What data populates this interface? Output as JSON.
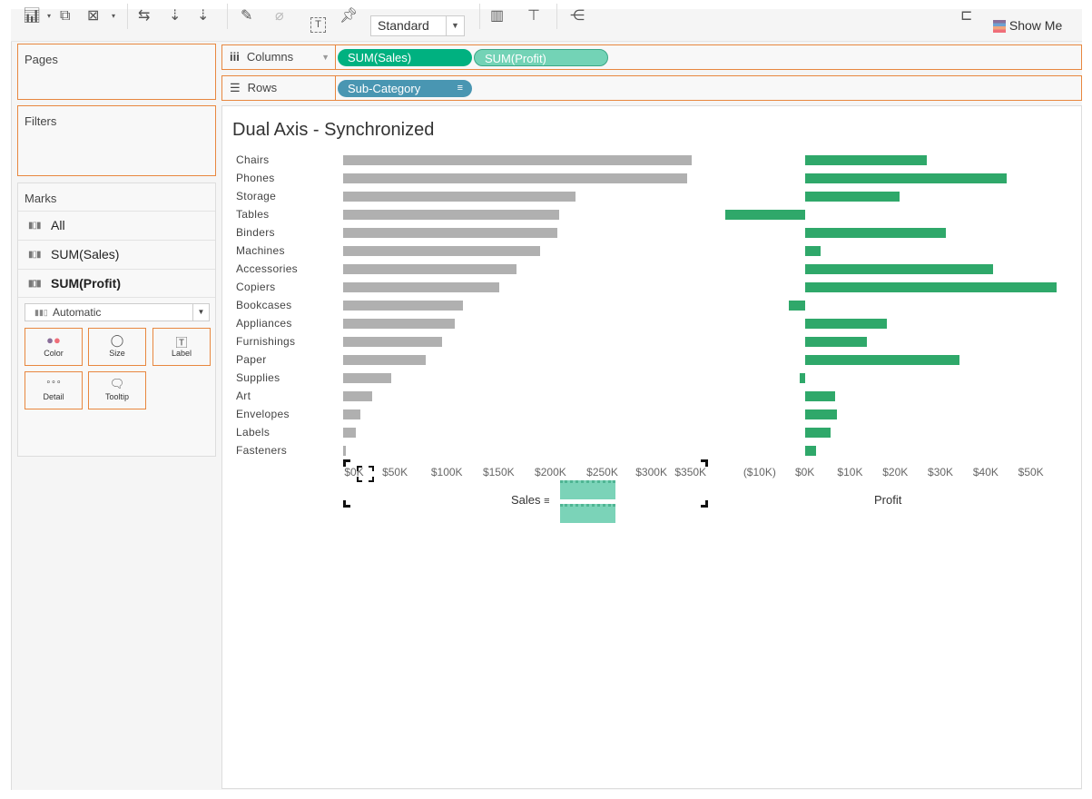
{
  "toolbar": {
    "mark_type_select": "Standard",
    "show_me_label": "Show Me",
    "icons": [
      "new-worksheet-icon",
      "duplicate-sheet-icon",
      "clear-sheet-icon",
      "swap-icon",
      "sort-ascending-icon",
      "sort-descending-icon",
      "highlight-icon",
      "group-icon",
      "label-icon",
      "pin-icon",
      "fit-icon",
      "presentation-icon",
      "share-icon",
      "signpost-icon",
      "show-me-icon"
    ]
  },
  "pages": {
    "title": "Pages"
  },
  "filters": {
    "title": "Filters"
  },
  "marks": {
    "title": "Marks",
    "rows": [
      {
        "label": "All"
      },
      {
        "label": "SUM(Sales)"
      },
      {
        "label": "SUM(Profit)"
      }
    ],
    "mark_type": "Automatic",
    "cards": [
      {
        "label": "Color"
      },
      {
        "label": "Size"
      },
      {
        "label": "Label"
      },
      {
        "label": "Detail"
      },
      {
        "label": "Tooltip"
      }
    ]
  },
  "shelves": {
    "columns": {
      "label": "Columns",
      "pills": [
        "SUM(Sales)",
        "SUM(Profit)"
      ]
    },
    "rows": {
      "label": "Rows",
      "pills": [
        "Sub-Category"
      ]
    }
  },
  "colors": {
    "sales_bar": "#b0b0b0",
    "profit_bar": "#2fa86a",
    "measure_pill": "#00b180",
    "measure_pill_light": "#73d3b6",
    "dimension_pill": "#4996b2",
    "shelf_border": "#e8873f"
  },
  "viz": {
    "title": "Dual Axis - Synchronized"
  },
  "chart_data": [
    {
      "type": "bar",
      "orientation": "horizontal",
      "xlabel": "Sales",
      "categories": [
        "Chairs",
        "Phones",
        "Storage",
        "Tables",
        "Binders",
        "Machines",
        "Accessories",
        "Copiers",
        "Bookcases",
        "Appliances",
        "Furnishings",
        "Paper",
        "Supplies",
        "Art",
        "Envelopes",
        "Labels",
        "Fasteners"
      ],
      "values": [
        336000,
        332000,
        224500,
        208000,
        207000,
        190000,
        167500,
        151000,
        116000,
        108000,
        95500,
        80000,
        46500,
        28000,
        16500,
        12500,
        3000
      ],
      "xlim": [
        0,
        352000
      ],
      "ticks": [
        "$0K",
        "$50K",
        "$100K",
        "$150K",
        "$200K",
        "$250K",
        "$300K",
        "$350K"
      ],
      "grid": false,
      "sorted": "descending"
    },
    {
      "type": "bar",
      "orientation": "horizontal",
      "xlabel": "Profit",
      "categories": [
        "Chairs",
        "Phones",
        "Storage",
        "Tables",
        "Binders",
        "Machines",
        "Accessories",
        "Copiers",
        "Bookcases",
        "Appliances",
        "Furnishings",
        "Paper",
        "Supplies",
        "Art",
        "Envelopes",
        "Labels",
        "Fasteners"
      ],
      "values": [
        27000,
        44600,
        21000,
        -17600,
        31200,
        3400,
        41600,
        55600,
        -3600,
        18200,
        13800,
        34200,
        -1200,
        6600,
        7000,
        5600,
        2400
      ],
      "xlim": [
        -18000,
        58500
      ],
      "ticks": [
        "($10K)",
        "$0K",
        "$10K",
        "$20K",
        "$30K",
        "$40K",
        "$50K"
      ],
      "grid": false
    }
  ]
}
